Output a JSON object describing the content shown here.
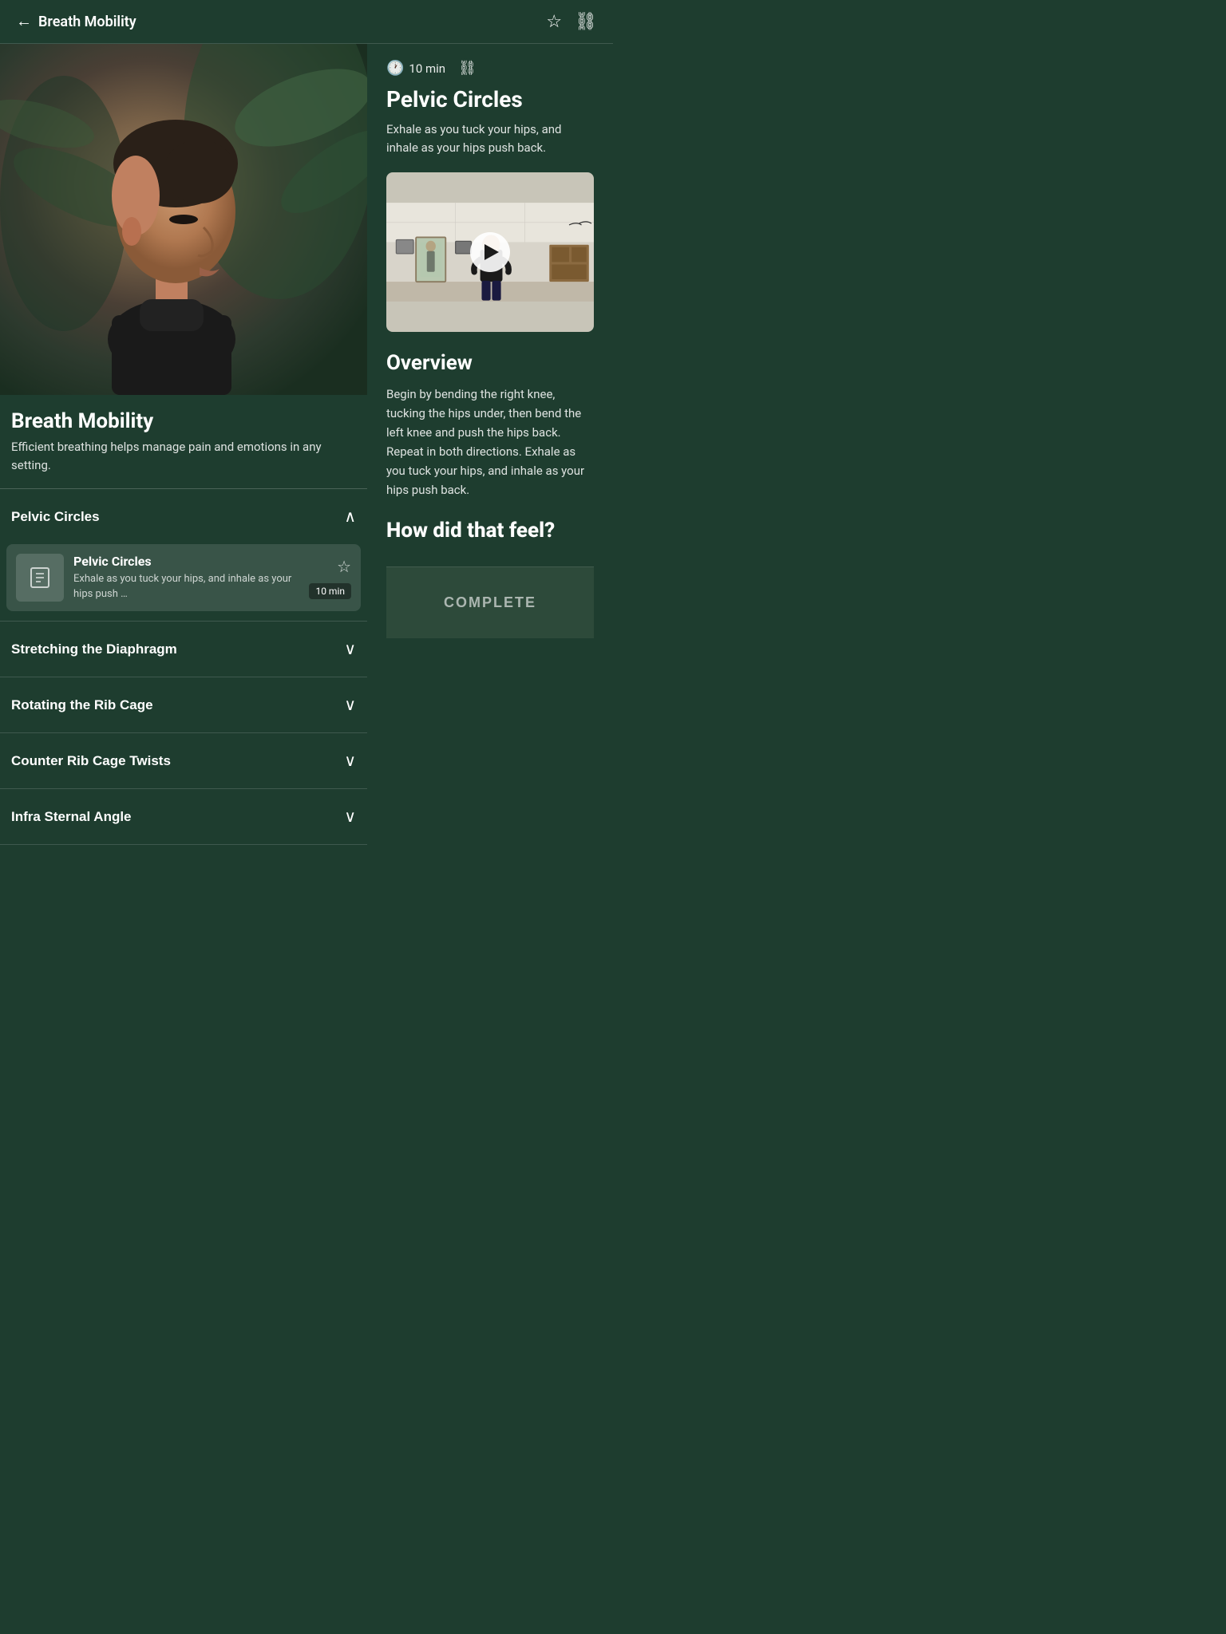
{
  "header": {
    "back_label": "←",
    "title": "Breath Mobility",
    "bookmark_icon": "☆",
    "link_icon": "⛓"
  },
  "program": {
    "title": "Breath Mobility",
    "description": "Efficient breathing helps manage pain and emotions in any setting."
  },
  "current_exercise": {
    "duration": "10 min",
    "title": "Pelvic Circles",
    "short_desc": "Exhale as you tuck your hips, and inhale as your hips push back.",
    "overview_title": "Overview",
    "overview_text": "Begin by bending the right knee, tucking the hips under, then bend the left knee and push the hips back. Repeat in both directions. Exhale as you tuck your hips, and inhale as your hips push back.",
    "feel_title": "How did that feel?"
  },
  "accordion": {
    "sections": [
      {
        "title": "Pelvic Circles",
        "expanded": true,
        "exercises": [
          {
            "name": "Pelvic Circles",
            "desc": "Exhale as you tuck your hips, and inhale as your hips push …",
            "duration": "10 min",
            "starred": false
          }
        ]
      },
      {
        "title": "Stretching the Diaphragm",
        "expanded": false,
        "exercises": []
      },
      {
        "title": "Rotating the Rib Cage",
        "expanded": false,
        "exercises": []
      },
      {
        "title": "Counter Rib Cage Twists",
        "expanded": false,
        "exercises": []
      },
      {
        "title": "Infra Sternal Angle",
        "expanded": false,
        "exercises": []
      }
    ]
  },
  "complete_button": {
    "label": "COMPLETE"
  }
}
